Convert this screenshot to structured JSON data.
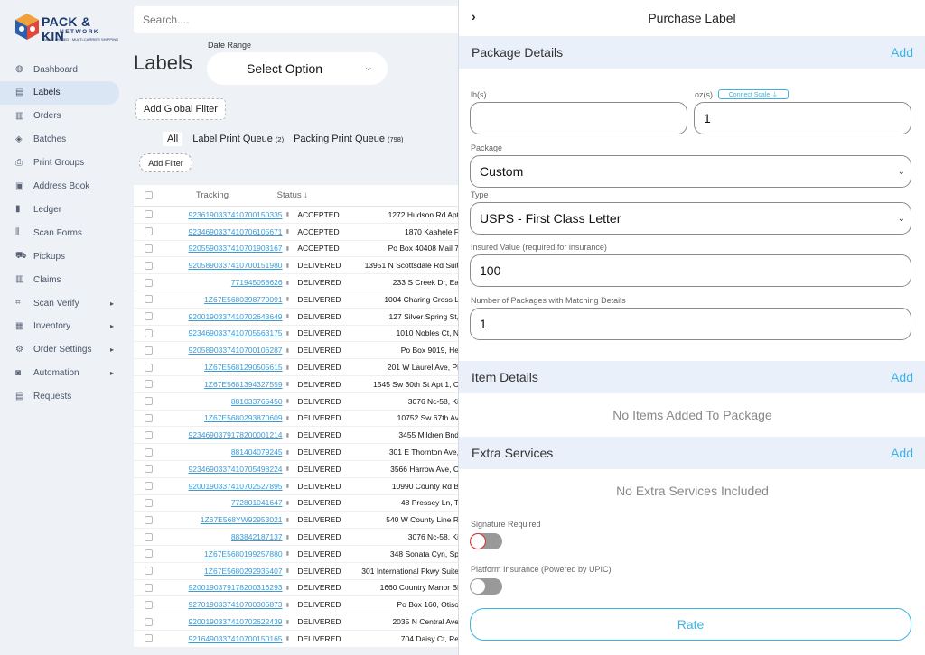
{
  "brand": {
    "name": "PACK & KIN",
    "sub": "NETWORK",
    "tagline": "FAMILY OWNED · MULTI-CARRIER SHIPPING"
  },
  "sidebar": {
    "items": [
      {
        "label": "Dashboard",
        "icon": "globe-icon"
      },
      {
        "label": "Labels",
        "icon": "document-icon",
        "active": true
      },
      {
        "label": "Orders",
        "icon": "database-icon"
      },
      {
        "label": "Batches",
        "icon": "layers-icon"
      },
      {
        "label": "Print Groups",
        "icon": "printer-icon"
      },
      {
        "label": "Address Book",
        "icon": "address-book-icon"
      },
      {
        "label": "Ledger",
        "icon": "book-icon"
      },
      {
        "label": "Scan Forms",
        "icon": "barcode-icon"
      },
      {
        "label": "Pickups",
        "icon": "truck-icon"
      },
      {
        "label": "Claims",
        "icon": "database-icon"
      },
      {
        "label": "Scan Verify",
        "icon": "barcode-scan-icon",
        "has_children": true
      },
      {
        "label": "Inventory",
        "icon": "box-icon",
        "has_children": true
      },
      {
        "label": "Order Settings",
        "icon": "gears-icon",
        "has_children": true
      },
      {
        "label": "Automation",
        "icon": "robot-icon",
        "has_children": true
      },
      {
        "label": "Requests",
        "icon": "document-icon"
      }
    ]
  },
  "search": {
    "placeholder": "Search...."
  },
  "page": {
    "title": "Labels"
  },
  "date_range": {
    "label": "Date Range",
    "value": "Select Option"
  },
  "add_global_filter": "Add Global Filter",
  "tabs": [
    {
      "label": "All",
      "count": ""
    },
    {
      "label": "Label Print Queue",
      "count": "(2)"
    },
    {
      "label": "Packing Print Queue",
      "count": "(798)"
    }
  ],
  "add_filter": "Add Filter",
  "table": {
    "columns": {
      "tracking": "Tracking",
      "status": "Status ↓"
    },
    "rows": [
      {
        "tracking": "9236190337410700150335",
        "status": "ACCEPTED",
        "address": "1272 Hudson Rd Apt"
      },
      {
        "tracking": "9234690337410706105671",
        "status": "ACCEPTED",
        "address": "1870 Kaahele F"
      },
      {
        "tracking": "9205590337410701903167",
        "status": "ACCEPTED",
        "address": "Po Box 40408 Mail 7"
      },
      {
        "tracking": "9205890337410700151980",
        "status": "DELIVERED",
        "address": "13951 N Scottsdale Rd Suit"
      },
      {
        "tracking": "771945058626",
        "status": "DELIVERED",
        "address": "233 S Creek Dr, Ea"
      },
      {
        "tracking": "1Z67E5680398770091",
        "status": "DELIVERED",
        "address": "1004 Charing Cross L"
      },
      {
        "tracking": "9200190337410702643649",
        "status": "DELIVERED",
        "address": "127 Silver Spring St,"
      },
      {
        "tracking": "9234690337410705563175",
        "status": "DELIVERED",
        "address": "1010 Nobles Ct, N"
      },
      {
        "tracking": "9205890337410700106287",
        "status": "DELIVERED",
        "address": "Po Box 9019, He"
      },
      {
        "tracking": "1Z67E5681290505615",
        "status": "DELIVERED",
        "address": "201 W Laurel Ave, Pl"
      },
      {
        "tracking": "1Z67E5681394327559",
        "status": "DELIVERED",
        "address": "1545 Sw 30th St Apt 1, C"
      },
      {
        "tracking": "881033765450",
        "status": "DELIVERED",
        "address": "3076 Nc-58, Ki"
      },
      {
        "tracking": "1Z67E5680293870609",
        "status": "DELIVERED",
        "address": "10752 Sw 67th Av"
      },
      {
        "tracking": "9234690379178200001214",
        "status": "DELIVERED",
        "address": "3455 Mildren Bnd"
      },
      {
        "tracking": "881404079245",
        "status": "DELIVERED",
        "address": "301 E Thornton Ave,"
      },
      {
        "tracking": "9234690337410705498224",
        "status": "DELIVERED",
        "address": "3566 Harrow Ave, C"
      },
      {
        "tracking": "9200190337410702527895",
        "status": "DELIVERED",
        "address": "10990 County Rd B"
      },
      {
        "tracking": "772801041647",
        "status": "DELIVERED",
        "address": "48 Pressey Ln, T"
      },
      {
        "tracking": "1Z67E568YW92953021",
        "status": "DELIVERED",
        "address": "540 W County Line R"
      },
      {
        "tracking": "883842187137",
        "status": "DELIVERED",
        "address": "3076 Nc-58, Ki"
      },
      {
        "tracking": "1Z67E5680199257880",
        "status": "DELIVERED",
        "address": "348 Sonata Cyn, Sp"
      },
      {
        "tracking": "1Z67E5680292935407",
        "status": "DELIVERED",
        "address": "301 International Pkwy Suite"
      },
      {
        "tracking": "9200190379178200316293",
        "status": "DELIVERED",
        "address": "1660 Country Manor Bl"
      },
      {
        "tracking": "9270190337410700306873",
        "status": "DELIVERED",
        "address": "Po Box 160, Otiso"
      },
      {
        "tracking": "9200190337410702622439",
        "status": "DELIVERED",
        "address": "2035 N Central Ave"
      },
      {
        "tracking": "9216490337410700150165",
        "status": "DELIVERED",
        "address": "704 Daisy Ct, Re"
      }
    ]
  },
  "panel": {
    "title": "Purchase Label",
    "package_details": {
      "title": "Package Details",
      "add": "Add"
    },
    "lbs": {
      "label": "lb(s)",
      "value": ""
    },
    "oz": {
      "label": "oz(s)",
      "value": "1",
      "connect_scale": "Connect Scale ⏚"
    },
    "package": {
      "label": "Package",
      "value": "Custom"
    },
    "type": {
      "label": "Type",
      "value": "USPS - First Class Letter"
    },
    "insured": {
      "label": "Insured Value (required for insurance)",
      "value": "100"
    },
    "num_packages": {
      "label": "Number of Packages with Matching Details",
      "value": "1"
    },
    "item_details": {
      "title": "Item Details",
      "add": "Add",
      "empty": "No Items Added To Package"
    },
    "extra_services": {
      "title": "Extra Services",
      "add": "Add",
      "empty": "No Extra Services Included"
    },
    "signature": {
      "label": "Signature Required",
      "on": false
    },
    "platform_insurance": {
      "label": "Platform Insurance (Powered by UPIC)",
      "on": false
    },
    "rate": "Rate"
  }
}
